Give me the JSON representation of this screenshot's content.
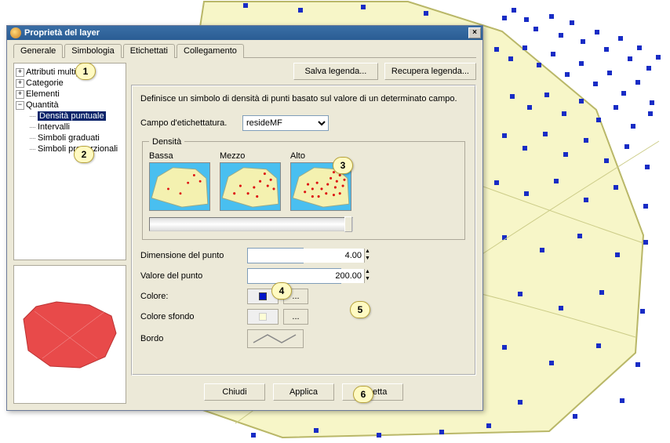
{
  "dialog": {
    "title": "Proprietà del layer",
    "close_glyph": "×",
    "tabs": {
      "generale": "Generale",
      "simbologia": "Simbologia",
      "etichettati": "Etichettati",
      "collegamento": "Collegamento"
    },
    "legend_buttons": {
      "save": "Salva legenda...",
      "load": "Recupera legenda..."
    },
    "tree": {
      "attributi_multipli": "Attributi multipli",
      "categorie": "Categorie",
      "elementi": "Elementi",
      "quantita": {
        "label": "Quantità",
        "densita_puntuale": "Densità puntuale",
        "intervalli": "Intervalli",
        "simboli_graduati": "Simboli graduati",
        "simboli_proporzionali": "Simboli proporzionali"
      }
    },
    "description": "Definisce un simbolo di densità di punti basato sul valore di un determinato campo.",
    "label_field": {
      "label": "Campo d'etichettatura.",
      "value": "resideMF"
    },
    "density": {
      "legend": "Densità",
      "bassa": "Bassa",
      "mezzo": "Mezzo",
      "alto": "Alto"
    },
    "point_size": {
      "label": "Dimensione del punto",
      "value": "4.00"
    },
    "point_value": {
      "label": "Valore del punto",
      "value": "200.00"
    },
    "color": {
      "label": "Colore:",
      "more": "..."
    },
    "bgcolor": {
      "label": "Colore sfondo",
      "more": "..."
    },
    "border": {
      "label": "Bordo"
    },
    "buttons": {
      "close": "Chiudi",
      "apply": "Applica",
      "accept": "Accetta"
    }
  },
  "callouts": {
    "c1": "1",
    "c2": "2",
    "c3": "3",
    "c4": "4",
    "c5": "5",
    "c6": "6"
  }
}
